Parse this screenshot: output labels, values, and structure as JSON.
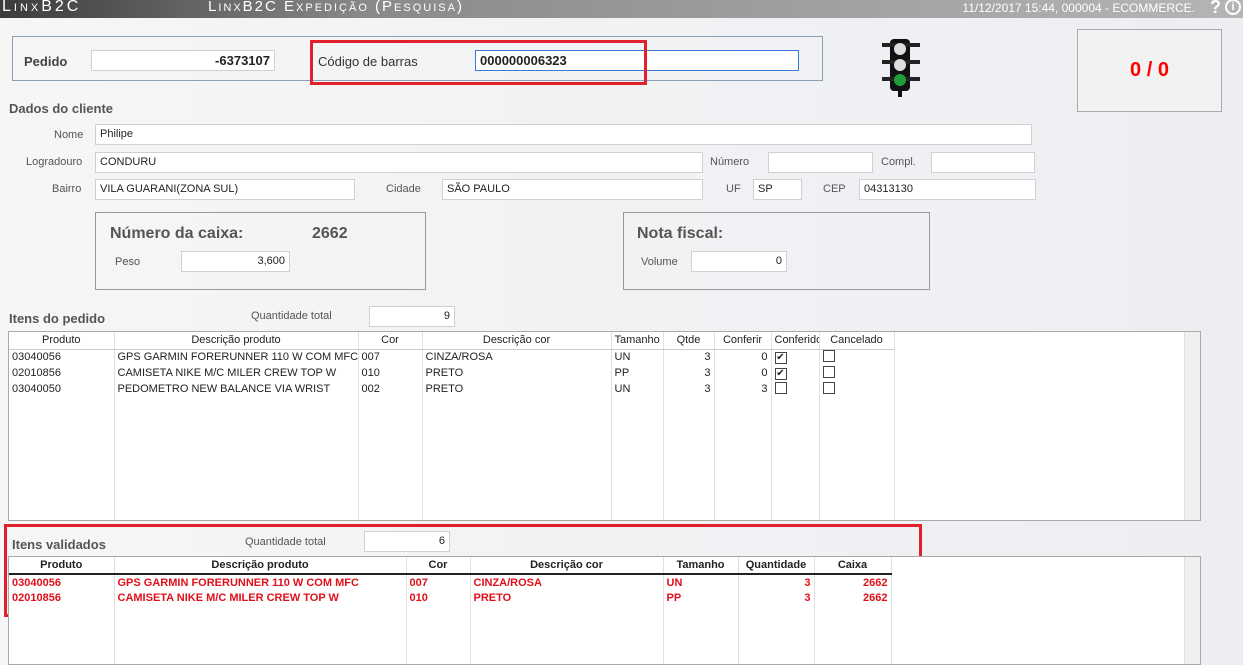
{
  "app": {
    "logo": "LinxB2C",
    "title": "LinxB2C Expedição (Pesquisa)",
    "status": "11/12/2017 15:44, 000004 - ECOMMERCE.",
    "help": "?",
    "info": "i"
  },
  "search": {
    "pedido_label": "Pedido",
    "pedido_value": "-6373107",
    "barcode_label": "Código de barras",
    "barcode_value": "000000006323"
  },
  "traffic_light": {
    "active": "green",
    "color": "#1e9e3a"
  },
  "counter": {
    "value": "0 / 0",
    "color": "#ff0000"
  },
  "cliente": {
    "title": "Dados do cliente",
    "nome_label": "Nome",
    "nome": "Philipe",
    "logradouro_label": "Logradouro",
    "logradouro": "CONDURU",
    "numero_label": "Número",
    "numero": "",
    "compl_label": "Compl.",
    "compl": "",
    "bairro_label": "Bairro",
    "bairro": "VILA GUARANI(ZONA SUL)",
    "cidade_label": "Cidade",
    "cidade": "SÃO PAULO",
    "uf_label": "UF",
    "uf": "SP",
    "cep_label": "CEP",
    "cep": "04313130"
  },
  "caixa": {
    "title": "Número da caixa:",
    "numero": "2662",
    "peso_label": "Peso",
    "peso": "3,600"
  },
  "nota": {
    "title": "Nota fiscal:",
    "volume_label": "Volume",
    "volume": "0"
  },
  "itens_pedido": {
    "title": "Itens do pedido",
    "qtd_label": "Quantidade total",
    "qtd": "9",
    "columns": [
      "Produto",
      "Descrição produto",
      "Cor",
      "Descrição cor",
      "Tamanho",
      "Qtde",
      "Conferir",
      "Conferido",
      "Cancelado"
    ],
    "rows": [
      {
        "produto": "03040056",
        "desc": "GPS GARMIN FORERUNNER 110 W COM MFC",
        "cor": "007",
        "desc_cor": "CINZA/ROSA",
        "tam": "UN",
        "qtde": "3",
        "conferir": "0",
        "conferido": true,
        "cancelado": false
      },
      {
        "produto": "02010856",
        "desc": "CAMISETA NIKE M/C MILER CREW TOP W",
        "cor": "010",
        "desc_cor": "PRETO",
        "tam": "PP",
        "qtde": "3",
        "conferir": "0",
        "conferido": true,
        "cancelado": false
      },
      {
        "produto": "03040050",
        "desc": "PEDOMETRO NEW BALANCE VIA WRIST",
        "cor": "002",
        "desc_cor": "PRETO",
        "tam": "UN",
        "qtde": "3",
        "conferir": "3",
        "conferido": false,
        "cancelado": false
      }
    ]
  },
  "itens_validados": {
    "title": "Itens validados",
    "qtd_label": "Quantidade total",
    "qtd": "6",
    "columns": [
      "Produto",
      "Descrição produto",
      "Cor",
      "Descrição cor",
      "Tamanho",
      "Quantidade",
      "Caixa"
    ],
    "rows": [
      {
        "produto": "03040056",
        "desc": "GPS GARMIN FORERUNNER 110 W COM MFC",
        "cor": "007",
        "desc_cor": "CINZA/ROSA",
        "tam": "UN",
        "qtd": "3",
        "caixa": "2662"
      },
      {
        "produto": "02010856",
        "desc": "CAMISETA NIKE M/C MILER CREW TOP W",
        "cor": "010",
        "desc_cor": "PRETO",
        "tam": "PP",
        "qtd": "3",
        "caixa": "2662"
      }
    ]
  }
}
